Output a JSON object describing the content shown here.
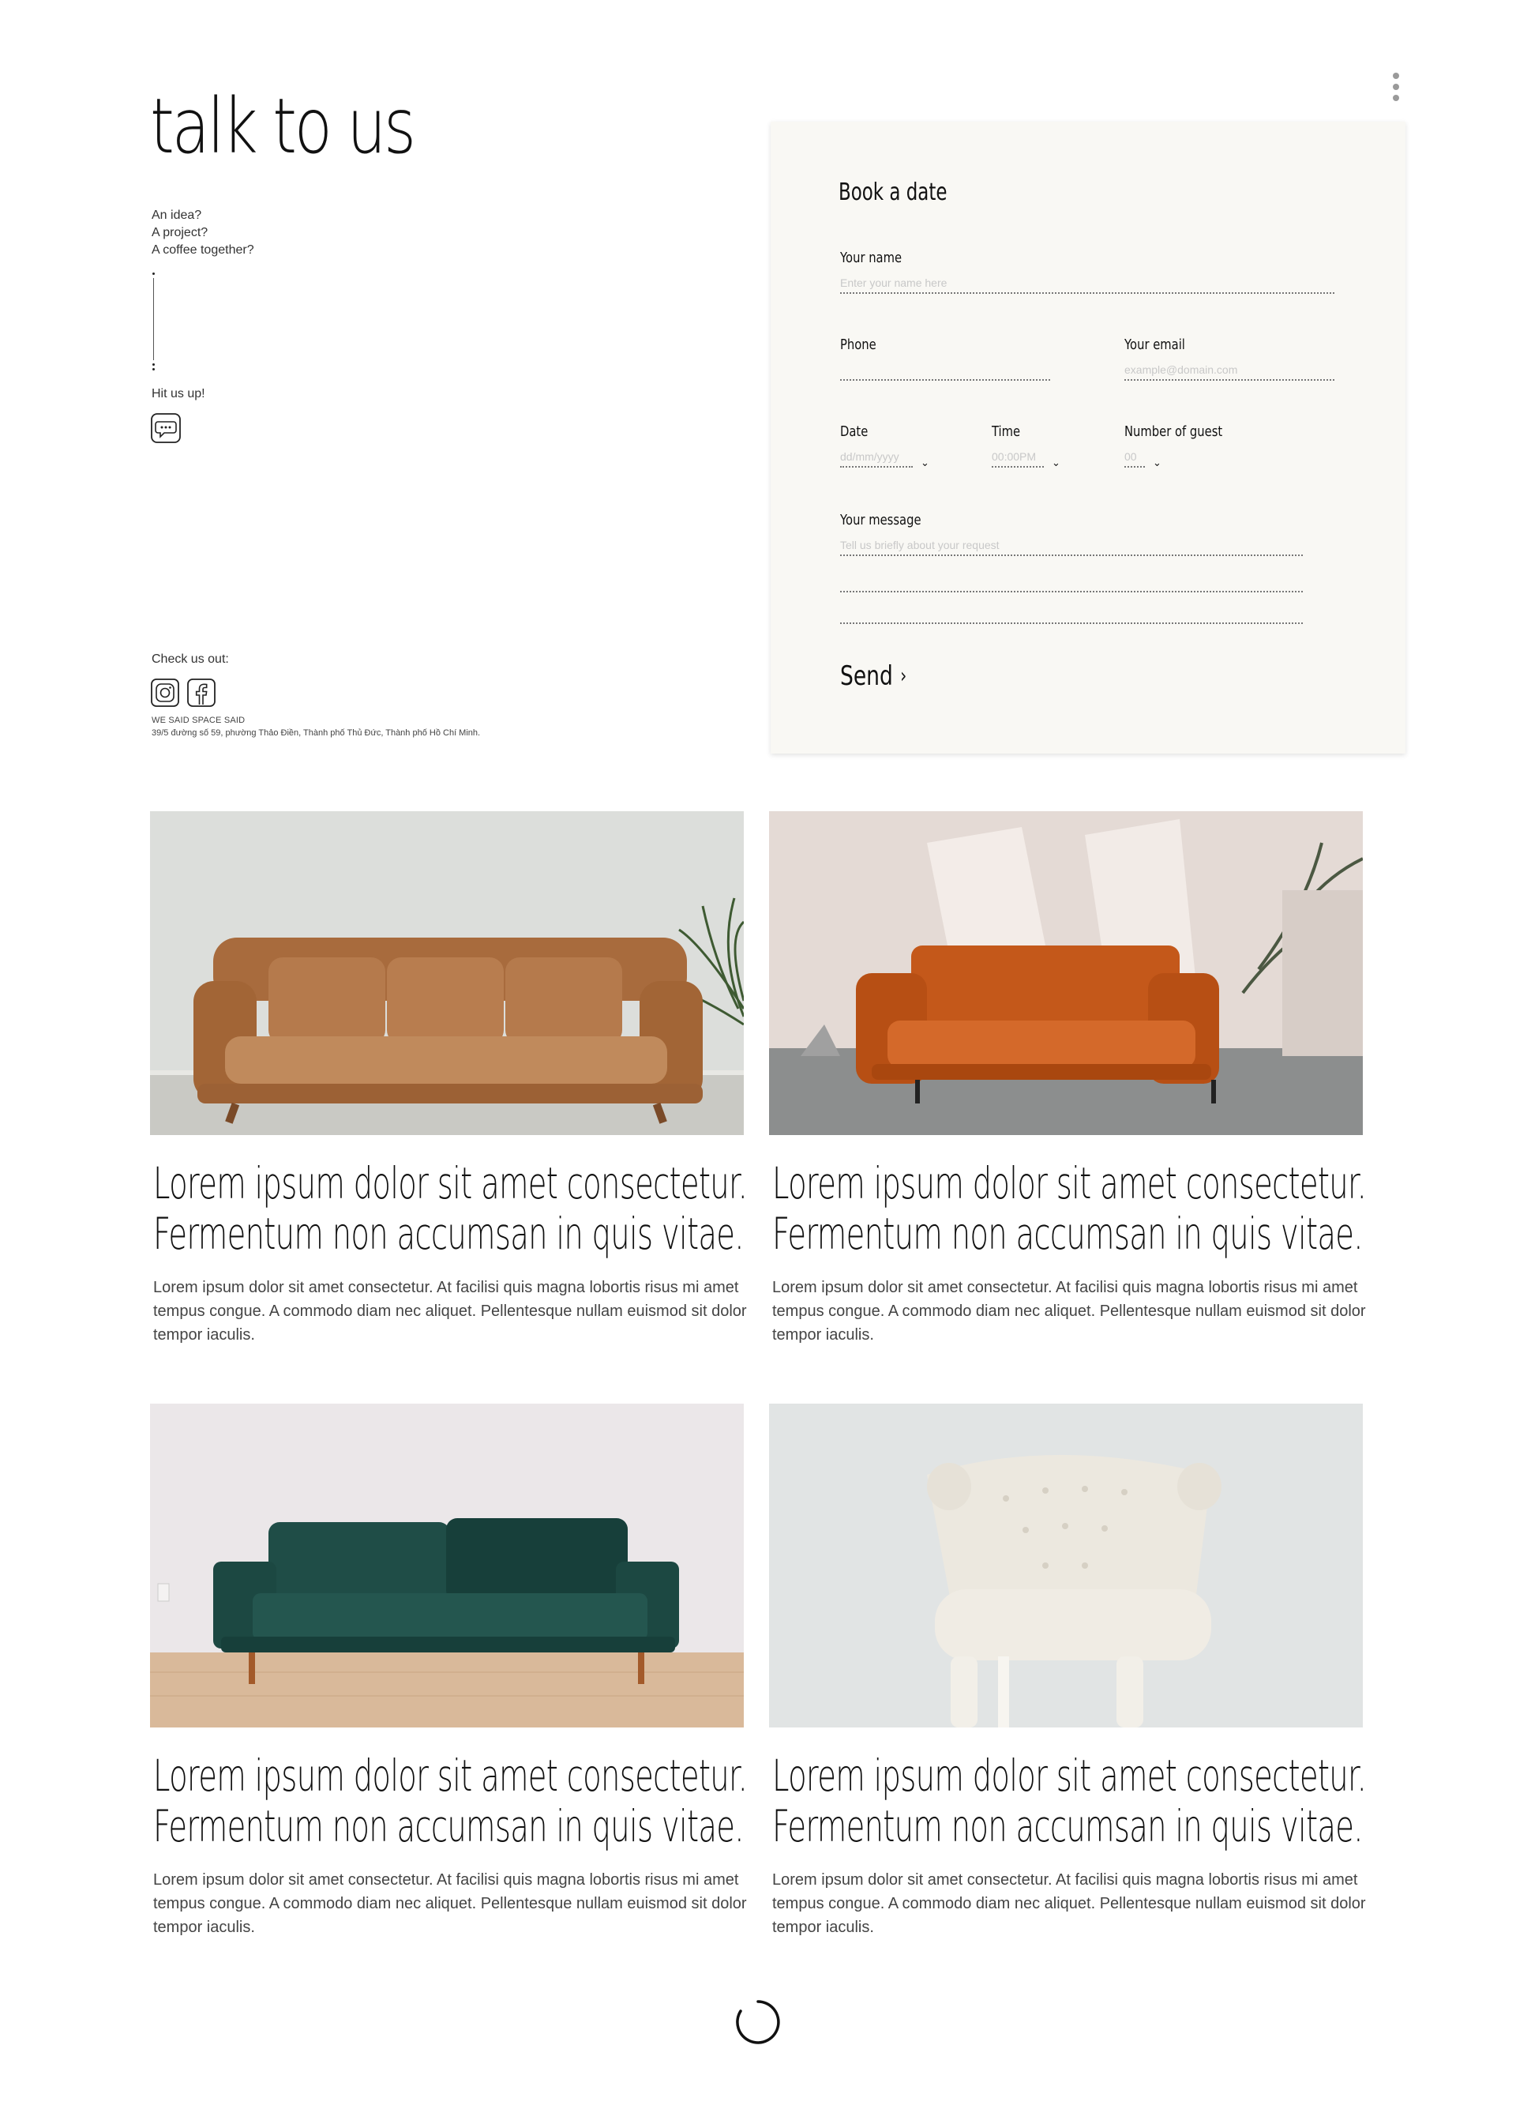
{
  "header": {
    "title": "talk to us",
    "menu_icon": "kebab-menu-icon"
  },
  "contact": {
    "intro_lines": [
      "An idea?",
      "A project?",
      "A coffee together?"
    ],
    "hit_text": "Hit us up!",
    "chat_icon": "chat-bubble-icon",
    "check_text": "Check us out:",
    "social_icons": [
      "instagram-icon",
      "facebook-icon"
    ],
    "company": "WE SAID SPACE SAID",
    "address": "39/5 đường số 59, phường Thảo Điền, Thành phố Thủ Đức,  Thành phố Hồ Chí Minh."
  },
  "booking": {
    "title": "Book a date",
    "name": {
      "label": "Your name",
      "placeholder": "Enter your name here"
    },
    "phone": {
      "label": "Phone",
      "placeholder": ""
    },
    "email": {
      "label": "Your email",
      "placeholder": "example@domain.com"
    },
    "date": {
      "label": "Date",
      "placeholder": "dd/mm/yyyy"
    },
    "time": {
      "label": "Time",
      "placeholder": "00:00PM"
    },
    "guests": {
      "label": "Number of guest",
      "placeholder": "00"
    },
    "message": {
      "label": "Your message",
      "placeholder": "Tell us briefly about your request"
    },
    "send_label": "Send",
    "send_icon": "chevron-right-icon"
  },
  "products": [
    {
      "title1": "Lorem ipsum dolor sit amet consectetur.",
      "title2": "Fermentum non accumsan in quis vitae.",
      "body": "Lorem ipsum dolor sit amet consectetur. At facilisi quis magna lobortis risus mi amet tempus congue. A commodo diam nec aliquet. Pellentesque nullam euismod sit dolor tempor iaculis.",
      "image": "tan-leather-sofa",
      "colors": {
        "bg": "#dcdedb",
        "sofa": "#b5784a"
      }
    },
    {
      "title1": "Lorem ipsum dolor sit amet consectetur.",
      "title2": "Fermentum non accumsan in quis vitae.",
      "body": "Lorem ipsum dolor sit amet consectetur. At facilisi quis magna lobortis risus mi amet tempus congue. A commodo diam nec aliquet. Pellentesque nullam euismod sit dolor tempor iaculis.",
      "image": "orange-leather-sofa",
      "colors": {
        "bg": "#e6dcd6",
        "sofa": "#c8601e"
      }
    },
    {
      "title1": "Lorem ipsum dolor sit amet consectetur.",
      "title2": "Fermentum non accumsan in quis vitae.",
      "body": "Lorem ipsum dolor sit amet consectetur. At facilisi quis magna lobortis risus mi amet tempus congue. A commodo diam nec aliquet. Pellentesque nullam euismod sit dolor tempor iaculis.",
      "image": "green-velvet-sofa",
      "colors": {
        "bg": "#ece8ea",
        "sofa": "#1f4b46"
      }
    },
    {
      "title1": "Lorem ipsum dolor sit amet consectetur.",
      "title2": "Fermentum non accumsan in quis vitae.",
      "body": "Lorem ipsum dolor sit amet consectetur. At facilisi quis magna lobortis risus mi amet tempus congue. A commodo diam nec aliquet. Pellentesque nullam euismod sit dolor tempor iaculis.",
      "image": "white-tufted-chair",
      "colors": {
        "bg": "#e1e4e4",
        "sofa": "#ebe7de"
      }
    }
  ],
  "loader": {
    "icon": "loading-spinner-icon"
  }
}
